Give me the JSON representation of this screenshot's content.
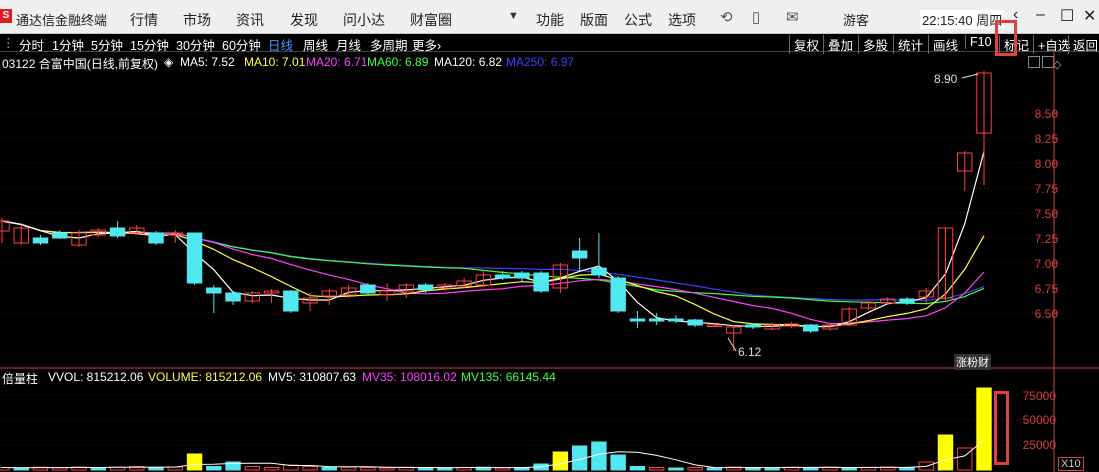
{
  "app": {
    "logo": "S",
    "title": "通达信金融终端"
  },
  "menu": [
    "行情",
    "市场",
    "资讯",
    "发现",
    "问小达",
    "财富圈",
    "功能",
    "版面",
    "公式",
    "选项"
  ],
  "user": "游客",
  "clock": "22:15:40 周四",
  "periods": [
    "分时",
    "1分钟",
    "5分钟",
    "15分钟",
    "30分钟",
    "60分钟",
    "日线",
    "周线",
    "月线",
    "多周期",
    "更多›"
  ],
  "active_period": "日线",
  "toolbar_right": [
    "复权",
    "叠加",
    "多股",
    "统计",
    "画线",
    "F10",
    "标记",
    "+自选",
    "返回"
  ],
  "stock": {
    "label": "03122 合富中国(日线,前复权)"
  },
  "ma": [
    {
      "text": "MA5: 7.52",
      "color": "#ffffff"
    },
    {
      "text": "MA10: 7.01",
      "color": "#ffff40"
    },
    {
      "text": "MA20: 6.71",
      "color": "#ff40ff"
    },
    {
      "text": "MA60: 6.89",
      "color": "#40ff40"
    },
    {
      "text": "MA120: 6.82",
      "color": "#ffffff"
    },
    {
      "text": "MA250: 6.97",
      "color": "#4040ff"
    }
  ],
  "price_axis": [
    "8.50",
    "8.25",
    "8.00",
    "7.75",
    "7.50",
    "7.25",
    "7.00",
    "6.75",
    "6.50"
  ],
  "high_label": "8.90",
  "low_label": "6.12",
  "badge": "涨粉财",
  "volume": {
    "label": "倍量柱",
    "items": [
      {
        "text": "VVOL: 815212.06",
        "color": "#ffffff"
      },
      {
        "text": "VOLUME: 815212.06",
        "color": "#ffff40"
      },
      {
        "text": "MV5: 310807.63",
        "color": "#ffffff"
      },
      {
        "text": "MV35: 108016.02",
        "color": "#ff40ff"
      },
      {
        "text": "MV135: 66145.44",
        "color": "#40ff40"
      }
    ],
    "axis": [
      "75000",
      "50000",
      "25000"
    ],
    "scale": "X10"
  },
  "colors": {
    "up": "#ff4040",
    "down": "#50e8f0",
    "yellow_bar": "#ffff00",
    "grid": "#800000"
  },
  "chart_data": {
    "type": "candlestick",
    "ylim": [
      6.0,
      9.0
    ],
    "candles": [
      {
        "o": 7.32,
        "c": 7.42,
        "h": 7.45,
        "l": 7.2
      },
      {
        "o": 7.2,
        "c": 7.35,
        "h": 7.38,
        "l": 7.18
      },
      {
        "o": 7.25,
        "c": 7.2,
        "h": 7.28,
        "l": 7.18
      },
      {
        "o": 7.3,
        "c": 7.25,
        "h": 7.33,
        "l": 7.24
      },
      {
        "o": 7.18,
        "c": 7.3,
        "h": 7.33,
        "l": 7.16
      },
      {
        "o": 7.28,
        "c": 7.33,
        "h": 7.35,
        "l": 7.26
      },
      {
        "o": 7.35,
        "c": 7.27,
        "h": 7.42,
        "l": 7.25
      },
      {
        "o": 7.3,
        "c": 7.35,
        "h": 7.38,
        "l": 7.28
      },
      {
        "o": 7.3,
        "c": 7.2,
        "h": 7.32,
        "l": 7.18
      },
      {
        "o": 7.28,
        "c": 7.3,
        "h": 7.33,
        "l": 7.2
      },
      {
        "o": 7.3,
        "c": 6.8,
        "h": 7.3,
        "l": 6.78
      },
      {
        "o": 6.75,
        "c": 6.7,
        "h": 6.78,
        "l": 6.5
      },
      {
        "o": 6.7,
        "c": 6.62,
        "h": 6.72,
        "l": 6.58
      },
      {
        "o": 6.62,
        "c": 6.7,
        "h": 6.72,
        "l": 6.6
      },
      {
        "o": 6.7,
        "c": 6.72,
        "h": 6.74,
        "l": 6.6
      },
      {
        "o": 6.72,
        "c": 6.52,
        "h": 6.73,
        "l": 6.5
      },
      {
        "o": 6.6,
        "c": 6.65,
        "h": 6.7,
        "l": 6.52
      },
      {
        "o": 6.67,
        "c": 6.72,
        "h": 6.74,
        "l": 6.58
      },
      {
        "o": 6.68,
        "c": 6.75,
        "h": 6.78,
        "l": 6.65
      },
      {
        "o": 6.78,
        "c": 6.7,
        "h": 6.8,
        "l": 6.68
      },
      {
        "o": 6.68,
        "c": 6.72,
        "h": 6.8,
        "l": 6.62
      },
      {
        "o": 6.72,
        "c": 6.78,
        "h": 6.8,
        "l": 6.65
      },
      {
        "o": 6.78,
        "c": 6.73,
        "h": 6.8,
        "l": 6.7
      },
      {
        "o": 6.75,
        "c": 6.78,
        "h": 6.8,
        "l": 6.72
      },
      {
        "o": 6.77,
        "c": 6.82,
        "h": 6.85,
        "l": 6.75
      },
      {
        "o": 6.78,
        "c": 6.88,
        "h": 6.92,
        "l": 6.76
      },
      {
        "o": 6.88,
        "c": 6.85,
        "h": 6.92,
        "l": 6.83
      },
      {
        "o": 6.9,
        "c": 6.85,
        "h": 6.92,
        "l": 6.82
      },
      {
        "o": 6.9,
        "c": 6.72,
        "h": 6.92,
        "l": 6.7
      },
      {
        "o": 6.75,
        "c": 6.98,
        "h": 7.0,
        "l": 6.7
      },
      {
        "o": 7.12,
        "c": 7.05,
        "h": 7.25,
        "l": 6.92
      },
      {
        "o": 6.95,
        "c": 6.88,
        "h": 7.3,
        "l": 6.85
      },
      {
        "o": 6.85,
        "c": 6.52,
        "h": 6.87,
        "l": 6.5
      },
      {
        "o": 6.44,
        "c": 6.42,
        "h": 6.52,
        "l": 6.35
      },
      {
        "o": 6.44,
        "c": 6.42,
        "h": 6.5,
        "l": 6.38
      },
      {
        "o": 6.44,
        "c": 6.42,
        "h": 6.48,
        "l": 6.4
      },
      {
        "o": 6.43,
        "c": 6.38,
        "h": 6.44,
        "l": 6.36
      },
      {
        "o": 6.38,
        "c": 6.38,
        "h": 6.4,
        "l": 6.36
      },
      {
        "o": 6.3,
        "c": 6.36,
        "h": 6.38,
        "l": 6.12
      },
      {
        "o": 6.38,
        "c": 6.36,
        "h": 6.4,
        "l": 6.34
      },
      {
        "o": 6.34,
        "c": 6.38,
        "h": 6.4,
        "l": 6.33
      },
      {
        "o": 6.37,
        "c": 6.39,
        "h": 6.41,
        "l": 6.35
      },
      {
        "o": 6.38,
        "c": 6.32,
        "h": 6.39,
        "l": 6.3
      },
      {
        "o": 6.34,
        "c": 6.38,
        "h": 6.4,
        "l": 6.32
      },
      {
        "o": 6.38,
        "c": 6.54,
        "h": 6.56,
        "l": 6.37
      },
      {
        "o": 6.55,
        "c": 6.6,
        "h": 6.62,
        "l": 6.53
      },
      {
        "o": 6.6,
        "c": 6.64,
        "h": 6.66,
        "l": 6.58
      },
      {
        "o": 6.64,
        "c": 6.6,
        "h": 6.66,
        "l": 6.58
      },
      {
        "o": 6.66,
        "c": 6.72,
        "h": 6.75,
        "l": 6.6
      },
      {
        "o": 6.65,
        "c": 7.35,
        "h": 7.35,
        "l": 6.62
      },
      {
        "o": 7.92,
        "c": 8.1,
        "h": 8.12,
        "l": 7.72
      },
      {
        "o": 8.3,
        "c": 8.9,
        "h": 8.92,
        "l": 7.78
      }
    ],
    "volume_ylim": [
      0,
      85000
    ],
    "volume": [
      {
        "v": 2500,
        "c": "up"
      },
      {
        "v": 2000,
        "c": "down"
      },
      {
        "v": 2800,
        "c": "up"
      },
      {
        "v": 2200,
        "c": "up"
      },
      {
        "v": 3000,
        "c": "up"
      },
      {
        "v": 2500,
        "c": "down"
      },
      {
        "v": 2800,
        "c": "up"
      },
      {
        "v": 3500,
        "c": "up"
      },
      {
        "v": 2500,
        "c": "down"
      },
      {
        "v": 3000,
        "c": "up"
      },
      {
        "v": 16000,
        "c": "yellow"
      },
      {
        "v": 3500,
        "c": "down"
      },
      {
        "v": 8000,
        "c": "down"
      },
      {
        "v": 3500,
        "c": "up"
      },
      {
        "v": 2500,
        "c": "up"
      },
      {
        "v": 5000,
        "c": "up"
      },
      {
        "v": 3500,
        "c": "up"
      },
      {
        "v": 2500,
        "c": "down"
      },
      {
        "v": 2800,
        "c": "up"
      },
      {
        "v": 2500,
        "c": "up"
      },
      {
        "v": 2000,
        "c": "up"
      },
      {
        "v": 2800,
        "c": "up"
      },
      {
        "v": 2500,
        "c": "down"
      },
      {
        "v": 2000,
        "c": "down"
      },
      {
        "v": 2500,
        "c": "up"
      },
      {
        "v": 2800,
        "c": "down"
      },
      {
        "v": 2000,
        "c": "up"
      },
      {
        "v": 2500,
        "c": "down"
      },
      {
        "v": 6000,
        "c": "down"
      },
      {
        "v": 18000,
        "c": "yellow"
      },
      {
        "v": 24000,
        "c": "down"
      },
      {
        "v": 28000,
        "c": "down"
      },
      {
        "v": 15000,
        "c": "down"
      },
      {
        "v": 3500,
        "c": "down"
      },
      {
        "v": 2500,
        "c": "up"
      },
      {
        "v": 2000,
        "c": "down"
      },
      {
        "v": 2500,
        "c": "up"
      },
      {
        "v": 2000,
        "c": "down"
      },
      {
        "v": 3000,
        "c": "up"
      },
      {
        "v": 2500,
        "c": "down"
      },
      {
        "v": 2000,
        "c": "down"
      },
      {
        "v": 2800,
        "c": "up"
      },
      {
        "v": 2500,
        "c": "down"
      },
      {
        "v": 3000,
        "c": "up"
      },
      {
        "v": 2000,
        "c": "down"
      },
      {
        "v": 2500,
        "c": "up"
      },
      {
        "v": 3000,
        "c": "up"
      },
      {
        "v": 2500,
        "c": "down"
      },
      {
        "v": 8000,
        "c": "up"
      },
      {
        "v": 35000,
        "c": "yellow"
      },
      {
        "v": 22000,
        "c": "up"
      },
      {
        "v": 82000,
        "c": "yellow"
      }
    ]
  }
}
